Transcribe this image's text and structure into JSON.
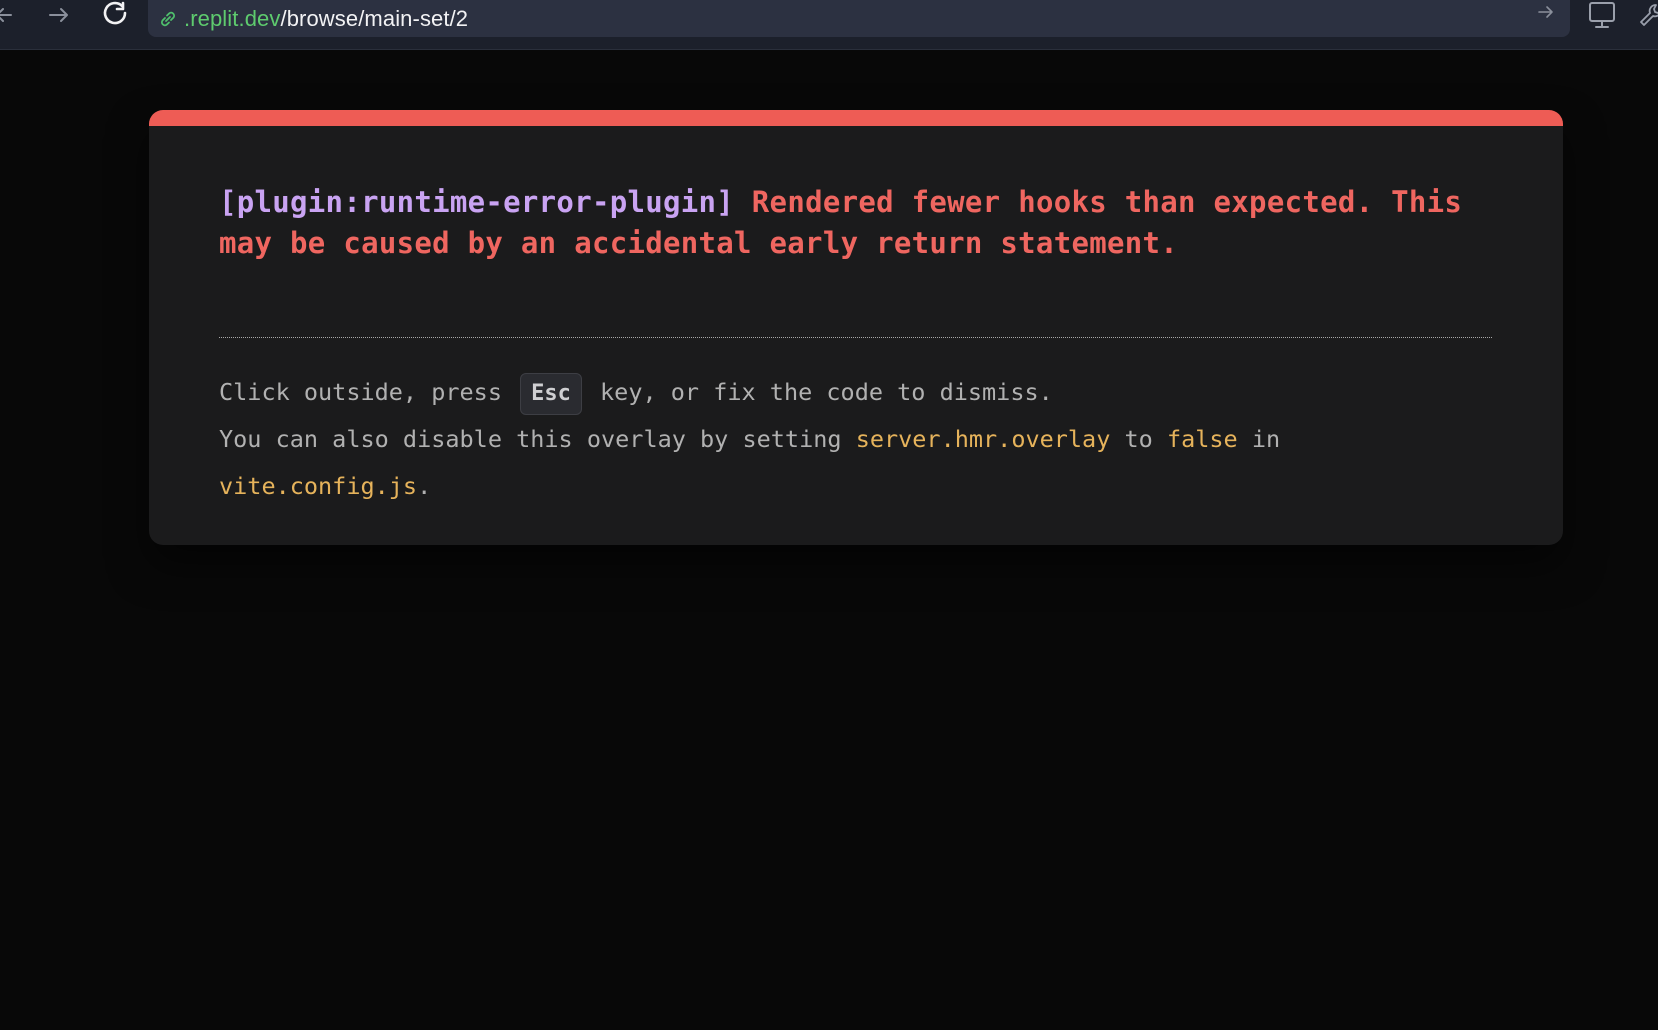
{
  "browser": {
    "url_domain": ".replit.dev",
    "url_path": "/browse/main-set/2"
  },
  "overlay": {
    "plugin": "[plugin:runtime-error-plugin]",
    "message": "Rendered fewer hooks than expected. This may be caused by an accidental early return statement.",
    "tip": {
      "line1_before": "Click outside, press",
      "key": "Esc",
      "line1_after": "key, or fix the code to dismiss.",
      "line2_before": "You can also disable this overlay by setting",
      "setting": "server.hmr.overlay",
      "to_word": "to",
      "value": "false",
      "in_word": "in",
      "config_file": "vite.config.js",
      "end": "."
    }
  },
  "colors": {
    "accent_bar": "#ee5c55",
    "error_text": "#ef6660",
    "plugin_text": "#c9a3f2",
    "code_text": "#e6b35b"
  }
}
